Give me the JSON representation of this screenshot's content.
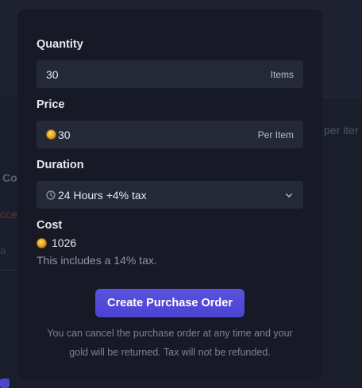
{
  "background": {
    "right_text": "per iter",
    "left_text_1": "Co",
    "left_text_2": "ccep",
    "left_text_3": "a"
  },
  "modal": {
    "quantity": {
      "label": "Quantity",
      "value": "30",
      "suffix": "Items"
    },
    "price": {
      "label": "Price",
      "value": "30",
      "suffix": "Per Item"
    },
    "duration": {
      "label": "Duration",
      "value": "24 Hours +4% tax"
    },
    "cost": {
      "label": "Cost",
      "value": "1026",
      "tax_note": "This includes a 14% tax."
    },
    "submit_label": "Create Purchase Order",
    "footnote": "You can cancel the purchase order at any time and your gold will be returned. Tax will not be refunded."
  },
  "colors": {
    "accent": "#4f48d6",
    "modal_bg": "#171a26",
    "field_bg": "#242938",
    "coin": "#e0a21a"
  },
  "icons": [
    "coin-icon",
    "clock-icon",
    "chevron-down-icon"
  ]
}
